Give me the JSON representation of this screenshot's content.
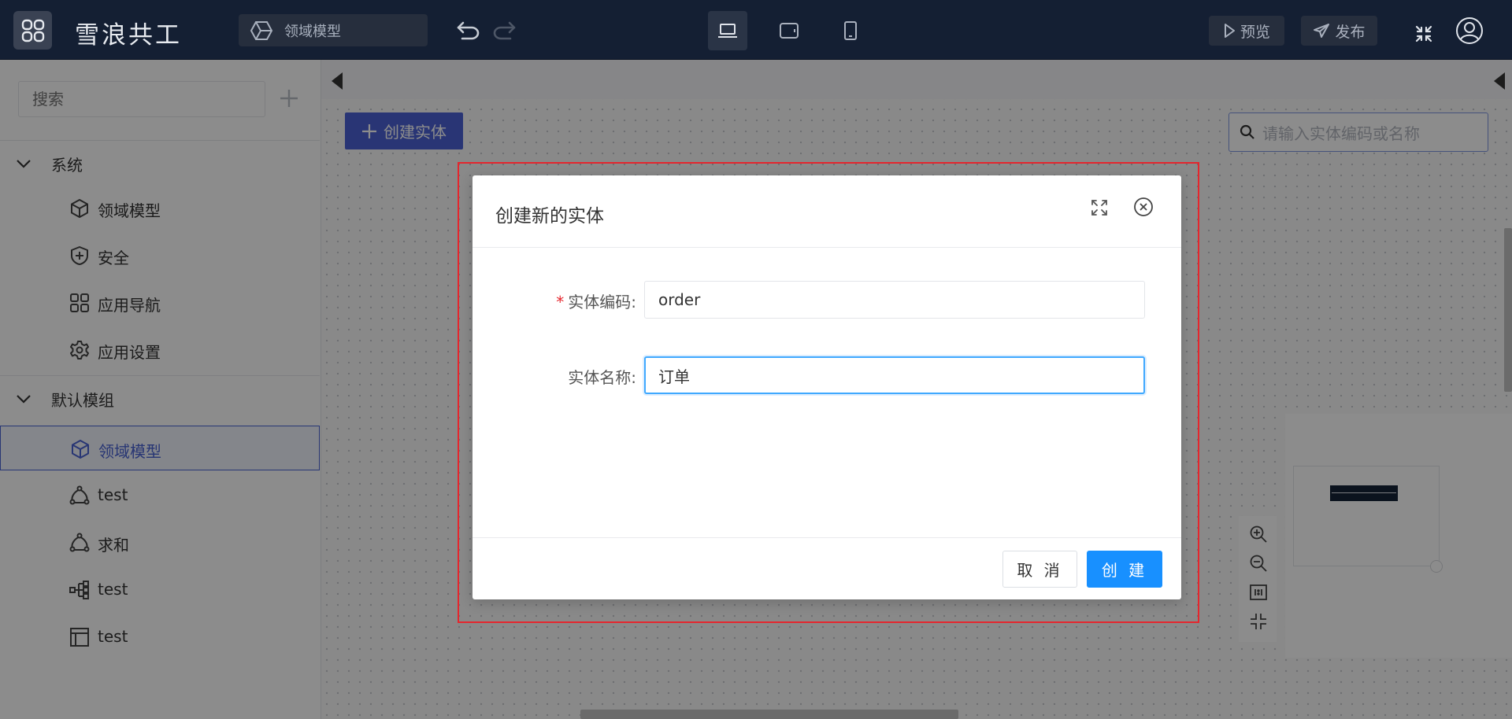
{
  "header": {
    "app_name": "雪浪共工",
    "module_selector": "领域模型",
    "preview_label": "预览",
    "publish_label": "发布"
  },
  "sidebar": {
    "search_placeholder": "搜索",
    "groups": [
      {
        "label": "系统",
        "items": [
          {
            "label": "领域模型",
            "icon": "cube-icon"
          },
          {
            "label": "安全",
            "icon": "shield-plus-icon"
          },
          {
            "label": "应用导航",
            "icon": "grid-icon"
          },
          {
            "label": "应用设置",
            "icon": "gear-icon"
          }
        ]
      },
      {
        "label": "默认模组",
        "items": [
          {
            "label": "领域模型",
            "icon": "cube-icon",
            "selected": true
          },
          {
            "label": "test",
            "icon": "flow-icon"
          },
          {
            "label": "求和",
            "icon": "flow-icon"
          },
          {
            "label": "test",
            "icon": "tree-icon"
          },
          {
            "label": "test",
            "icon": "table-icon"
          }
        ]
      }
    ]
  },
  "canvas": {
    "create_entity_label": "创建实体",
    "entity_search_placeholder": "请输入实体编码或名称"
  },
  "modal": {
    "title": "创建新的实体",
    "fields": [
      {
        "label": "实体编码:",
        "value": "order",
        "required": true
      },
      {
        "label": "实体名称:",
        "value": "订单",
        "required": false
      }
    ],
    "cancel_label": "取 消",
    "create_label": "创 建"
  },
  "colors": {
    "topbar": "#141f33",
    "accent": "#4b62d5",
    "primary_button": "#1890ff",
    "highlight_border": "#e5262d"
  }
}
